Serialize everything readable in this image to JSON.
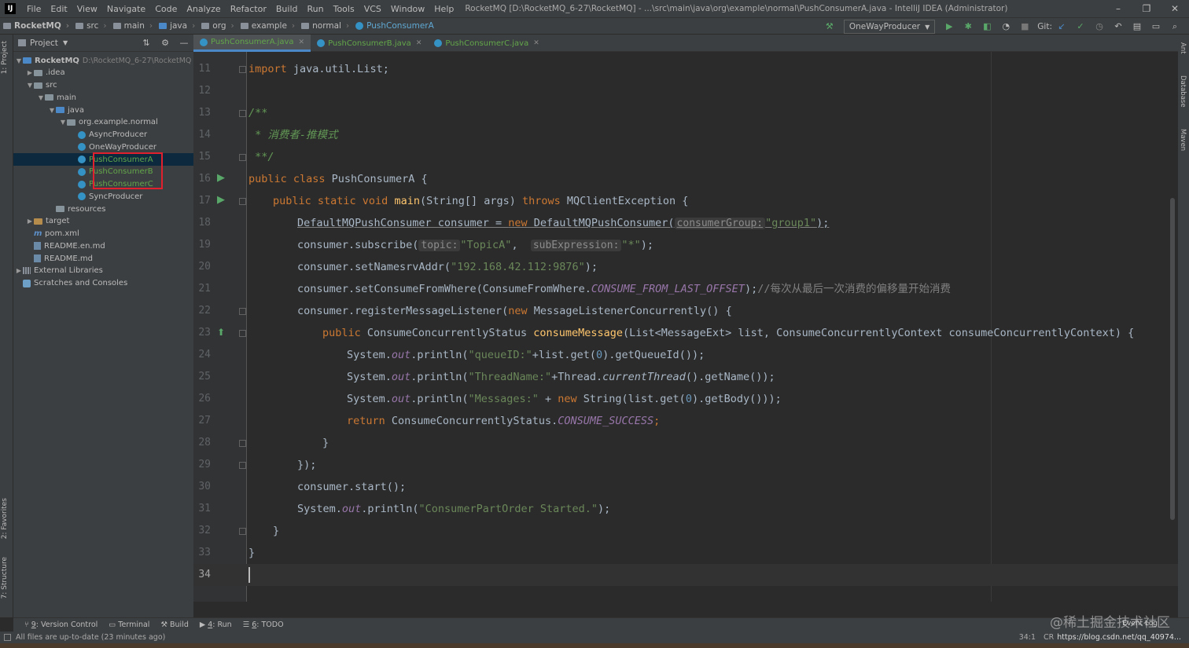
{
  "window": {
    "title": "RocketMQ [D:\\RocketMQ_6-27\\RocketMQ] - ...\\src\\main\\java\\org\\example\\normal\\PushConsumerA.java - IntelliJ IDEA (Administrator)",
    "app_icon": "IJ",
    "minimize": "–",
    "restore": "❐",
    "close": "✕"
  },
  "menu": [
    "File",
    "Edit",
    "View",
    "Navigate",
    "Code",
    "Analyze",
    "Refactor",
    "Build",
    "Run",
    "Tools",
    "VCS",
    "Window",
    "Help"
  ],
  "breadcrumbs": [
    "RocketMQ",
    "src",
    "main",
    "java",
    "org",
    "example",
    "normal",
    "PushConsumerA"
  ],
  "toolbar": {
    "run_config": "OneWayProducer",
    "git_label": "Git:",
    "icons": [
      "hammer-icon",
      "run-icon",
      "debug-icon",
      "coverage-icon",
      "profile-icon",
      "stop-icon",
      "git-update-icon",
      "git-commit-icon",
      "history-icon",
      "rollback-icon",
      "project-structure-icon",
      "layout-icon",
      "search-everywhere-icon"
    ]
  },
  "left_stripe": {
    "project_tab": "1: Project",
    "favorites_tab": "2: Favorites",
    "structure_tab": "7: Structure"
  },
  "right_stripe": {
    "ant_tab": "Ant",
    "database_tab": "Database",
    "maven_tab": "Maven"
  },
  "project_panel": {
    "header": "Project",
    "tree": [
      {
        "label": "RocketMQ",
        "detail": "D:\\RocketMQ_6-27\\RocketMQ",
        "icon": "module-folder-icon",
        "depth": 0,
        "arrow": "▼"
      },
      {
        "label": ".idea",
        "icon": "folder-icon",
        "depth": 1,
        "arrow": "▶"
      },
      {
        "label": "src",
        "icon": "folder-icon",
        "depth": 1,
        "arrow": "▼"
      },
      {
        "label": "main",
        "icon": "folder-icon",
        "depth": 2,
        "arrow": "▼"
      },
      {
        "label": "java",
        "icon": "source-folder-icon",
        "depth": 3,
        "arrow": "▼"
      },
      {
        "label": "org.example.normal",
        "icon": "package-icon",
        "depth": 4,
        "arrow": "▼"
      },
      {
        "label": "AsyncProducer",
        "icon": "class-icon",
        "depth": 5,
        "arrow": ""
      },
      {
        "label": "OneWayProducer",
        "icon": "class-icon",
        "depth": 5,
        "arrow": ""
      },
      {
        "label": "PushConsumerA",
        "icon": "class-icon",
        "depth": 5,
        "arrow": ""
      },
      {
        "label": "PushConsumerB",
        "icon": "class-icon",
        "depth": 5,
        "arrow": ""
      },
      {
        "label": "PushConsumerC",
        "icon": "class-icon",
        "depth": 5,
        "arrow": ""
      },
      {
        "label": "SyncProducer",
        "icon": "class-icon",
        "depth": 5,
        "arrow": ""
      },
      {
        "label": "resources",
        "icon": "resources-folder-icon",
        "depth": 3,
        "arrow": ""
      },
      {
        "label": "target",
        "icon": "excluded-folder-icon",
        "depth": 1,
        "arrow": "▶"
      },
      {
        "label": "pom.xml",
        "icon": "maven-file-icon",
        "depth": 1,
        "arrow": ""
      },
      {
        "label": "README.en.md",
        "icon": "markdown-file-icon",
        "depth": 1,
        "arrow": ""
      },
      {
        "label": "README.md",
        "icon": "markdown-file-icon",
        "depth": 1,
        "arrow": ""
      },
      {
        "label": "External Libraries",
        "icon": "library-icon",
        "depth": 0,
        "arrow": "▶"
      },
      {
        "label": "Scratches and Consoles",
        "icon": "scratches-icon",
        "depth": 0,
        "arrow": ""
      }
    ]
  },
  "tabs": [
    {
      "label": "PushConsumerA.java",
      "active": true
    },
    {
      "label": "PushConsumerB.java",
      "active": false
    },
    {
      "label": "PushConsumerC.java",
      "active": false
    }
  ],
  "editor": {
    "line_numbers": [
      "11",
      "12",
      "13",
      "14",
      "15",
      "16",
      "17",
      "18",
      "19",
      "20",
      "21",
      "22",
      "23",
      "24",
      "25",
      "26",
      "27",
      "28",
      "29",
      "30",
      "31",
      "32",
      "33",
      "34"
    ],
    "code": {
      "l11_import": "import",
      "l11_rest": " java.util.List;",
      "l13": "/**",
      "l14": " * 消费者-推模式",
      "l15": " **/",
      "l16_kw": "public class",
      "l16_name": " PushConsumerA {",
      "l17_kw": "public static void",
      "l17_fn": " main",
      "l17_params": "(String[] args) ",
      "l17_throws": "throws",
      "l17_ex": " MQClientException {",
      "l18_type": "DefaultMQPushConsumer consumer = ",
      "l18_new": "new",
      "l18_ctor": " DefaultMQPushConsumer(",
      "l18_hint": "consumerGroup:",
      "l18_str": "\"group1\"",
      "l18_end": ");",
      "l19_call": "consumer.subscribe(",
      "l19_hint1": "topic:",
      "l19_str1": "\"TopicA\"",
      "l19_sep": ",  ",
      "l19_hint2": "subExpression:",
      "l19_str2": "\"*\"",
      "l19_end": ");",
      "l20_call": "consumer.setNamesrvAddr(",
      "l20_str": "\"192.168.42.112:9876\"",
      "l20_end": ");",
      "l21_call": "consumer.setConsumeFromWhere(ConsumeFromWhere.",
      "l21_fld": "CONSUME_FROM_LAST_OFFSET",
      "l21_end": ");",
      "l21_cmt": "//每次从最后一次消费的偏移量开始消费",
      "l22_call": "consumer.registerMessageListener(",
      "l22_new": "new",
      "l22_rest": " MessageListenerConcurrently() {",
      "l23_kw": "public",
      "l23_type": " ConsumeConcurrentlyStatus ",
      "l23_fn": "consumeMessage",
      "l23_rest": "(List<MessageExt> list, ConsumeConcurrentlyContext consumeConcurrentlyContext) {",
      "l24_sys": "System.",
      "l24_out": "out",
      "l24_mid": ".println(",
      "l24_str": "\"queueID:\"",
      "l24_rest1": "+list.get(",
      "l24_num": "0",
      "l24_rest2": ").getQueueId());",
      "l25_sys": "System.",
      "l25_out": "out",
      "l25_mid": ".println(",
      "l25_str": "\"ThreadName:\"",
      "l25_rest1": "+Thread.",
      "l25_it": "currentThread",
      "l25_rest2": "().getName());",
      "l26_sys": "System.",
      "l26_out": "out",
      "l26_mid": ".println(",
      "l26_str": "\"Messages:\"",
      "l26_plus": " + ",
      "l26_new": "new",
      "l26_rest1": " String(list.get(",
      "l26_num": "0",
      "l26_rest2": ").getBody()));",
      "l27_kw": "return",
      "l27_rest": " ConsumeConcurrentlyStatus.",
      "l27_fld": "CONSUME_SUCCESS",
      "l27_end": ";",
      "l28": "}",
      "l29": "});",
      "l30": "consumer.start();",
      "l31_sys": "System.",
      "l31_out": "out",
      "l31_mid": ".println(",
      "l31_str": "\"ConsumerPartOrder Started.\"",
      "l31_end": ");",
      "l32": "}",
      "l33": "}"
    }
  },
  "bottom_tabs": [
    {
      "num": "9",
      "label": ": Version Control"
    },
    {
      "num": "",
      "label": "Terminal"
    },
    {
      "num": "",
      "label": "Build"
    },
    {
      "num": "4",
      "label": ": Run"
    },
    {
      "num": "6",
      "label": ": TODO"
    }
  ],
  "status": {
    "message": "All files are up-to-date (23 minutes ago)",
    "position": "34:1",
    "encoding_part": "CR",
    "url_part": "https://blog.csdn.net/qq_40974...",
    "event_log": "Event Log"
  },
  "watermark": "@稀土掘金技术社区",
  "colors": {
    "background": "#2b2b2b",
    "panel": "#3c3f41",
    "keyword": "#cc7832",
    "string": "#6a8759",
    "selection": "#0d293e",
    "highlight_box": "#e0202c"
  }
}
